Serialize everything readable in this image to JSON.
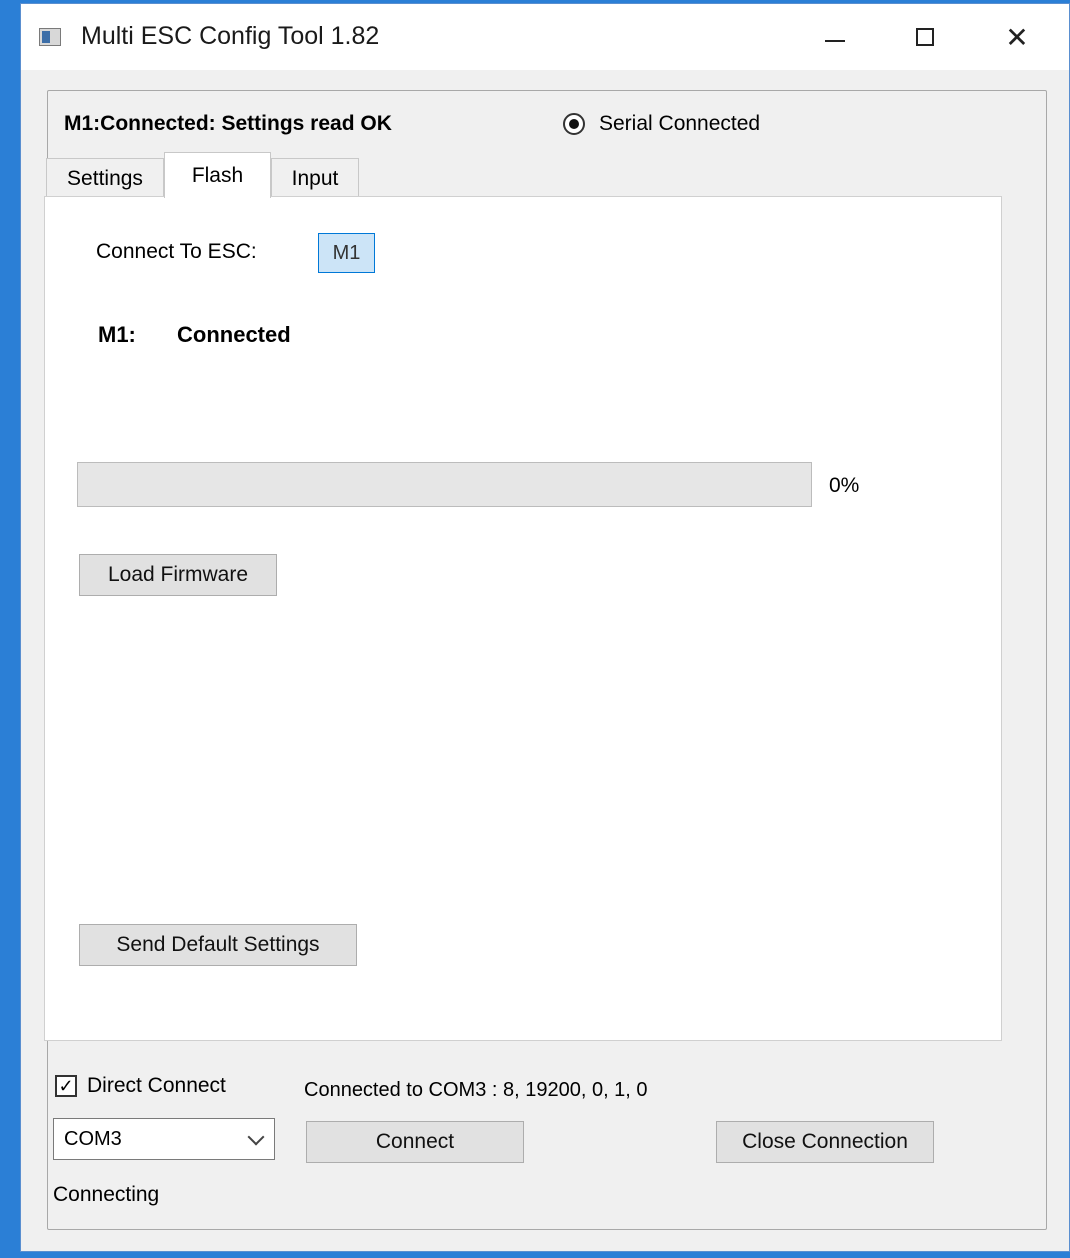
{
  "window": {
    "title": "Multi ESC Config Tool 1.82"
  },
  "header": {
    "status_text": "M1:Connected: Settings read OK",
    "radio_label": "Serial Connected",
    "radio_selected": true
  },
  "tabs": [
    {
      "label": "Settings",
      "active": false
    },
    {
      "label": "Flash",
      "active": true
    },
    {
      "label": "Input",
      "active": false
    }
  ],
  "flash": {
    "connect_label": "Connect To ESC:",
    "esc_button": "M1",
    "esc_name": "M1:",
    "esc_status": "Connected",
    "progress_percent": 0,
    "progress_text": "0%",
    "load_firmware_label": "Load Firmware",
    "send_default_label": "Send Default Settings"
  },
  "footer": {
    "direct_connect_label": "Direct Connect",
    "direct_connect_checked": true,
    "connection_info": "Connected to COM3 : 8, 19200, 0, 1, 0",
    "port_value": "COM3",
    "connect_label": "Connect",
    "close_connection_label": "Close Connection",
    "status": "Connecting"
  },
  "colors": {
    "desktop": "#2b7fd6",
    "selected_button": "#cce4f7",
    "progress_fill": "#06b025"
  }
}
